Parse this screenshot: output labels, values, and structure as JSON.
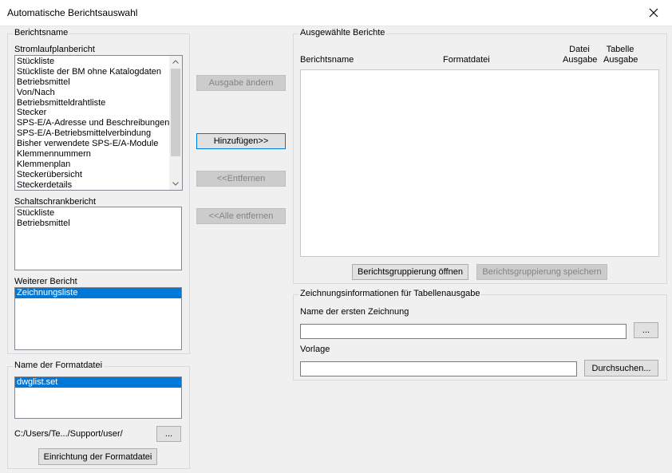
{
  "window": {
    "title": "Automatische Berichtsauswahl"
  },
  "berichtsname": {
    "legend": "Berichtsname",
    "stromlauf_label": "Stromlaufplanbericht",
    "stromlauf_items": [
      "Stückliste",
      "Stückliste der BM ohne Katalogdaten",
      "Betriebsmittel",
      "Von/Nach",
      "Betriebsmitteldrahtliste",
      "Stecker",
      "SPS-E/A-Adresse und Beschreibungen",
      "SPS-E/A-Betriebsmittelverbindung",
      "Bisher verwendete SPS-E/A-Module",
      "Klemmennummern",
      "Klemmenplan",
      "Steckerübersicht",
      "Steckerdetails"
    ],
    "schalt_label": "Schaltschrankbericht",
    "schalt_items": [
      "Stückliste",
      "Betriebsmittel"
    ],
    "weiterer_label": "Weiterer Bericht",
    "weiterer_items": [
      "Zeichnungsliste"
    ]
  },
  "formatdatei": {
    "legend": "Name der Formatdatei",
    "items": [
      "dwglist.set"
    ],
    "path": "C:/Users/Te.../Support/user/",
    "browse_label": "...",
    "setup_label": "Einrichtung der Formatdatei"
  },
  "middle": {
    "ausgabe_label": "Ausgabe ändern",
    "hinzufuegen_label": "Hinzufügen>>",
    "entfernen_label": "<<Entfernen",
    "alle_entfernen_label": "<<Alle entfernen"
  },
  "ausgewaehlt": {
    "legend": "Ausgewählte Berichte",
    "col_name": "Berichtsname",
    "col_format": "Formatdatei",
    "col_datei_1": "Datei",
    "col_datei_2": "Ausgabe",
    "col_tabelle_1": "Tabelle",
    "col_tabelle_2": "Ausgabe",
    "open_label": "Berichtsgruppierung öffnen",
    "save_label": "Berichtsgruppierung speichern"
  },
  "zeichnung": {
    "legend": "Zeichnungsinformationen für Tabellenausgabe",
    "erste_label": "Name der ersten Zeichnung",
    "erste_value": "",
    "browse_label": "...",
    "vorlage_label": "Vorlage",
    "vorlage_value": "",
    "durchsuchen_label": "Durchsuchen..."
  }
}
